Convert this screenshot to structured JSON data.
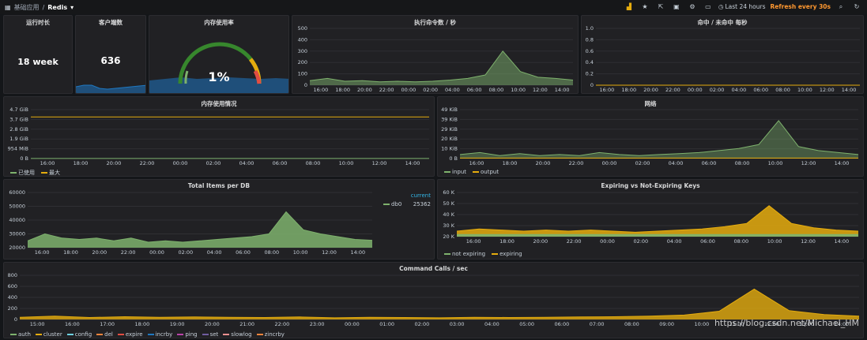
{
  "topbar": {
    "breadcrumb_parent": "基础应用",
    "separator": "/",
    "dashboard": "Redis",
    "time_range": "Last 24 hours",
    "refresh": "Refresh every 30s",
    "icons": [
      "graph-add-icon",
      "star-icon",
      "share-icon",
      "save-icon",
      "gear-icon",
      "tv-icon",
      "clock-icon",
      "zoom-out-icon",
      "refresh-icon"
    ]
  },
  "panels": {
    "uptime": {
      "title": "运行时长",
      "value": "18 week"
    },
    "clients": {
      "title": "客户端数",
      "value": "636"
    },
    "mem_usage": {
      "title": "内存使用率",
      "value": "1%"
    },
    "cmds_per_sec": {
      "title": "执行命令数 / 秒"
    },
    "hit_miss": {
      "title": "命中 / 未命中 每秒"
    },
    "mem_usage_detail": {
      "title": "内存使用情况"
    },
    "network": {
      "title": "网络"
    },
    "items_per_db": {
      "title": "Total Items per DB",
      "legend_header": "current",
      "legend_series": "db0",
      "legend_value": "25362"
    },
    "expiring": {
      "title": "Expiring vs Not-Expiring Keys"
    },
    "command_calls": {
      "title": "Command Calls / sec"
    }
  },
  "colors": {
    "green": "#7eb26d",
    "yellow": "#e5ac0e",
    "blue": "#1f78c1",
    "red": "#e24d42",
    "orange": "#ef843c",
    "cyan": "#6ed0e0",
    "purple": "#ba43a9",
    "pink": "#f29191",
    "violet": "#705da0",
    "mint": "#badff4"
  },
  "chart_data": [
    {
      "id": "cmds_per_sec",
      "type": "area",
      "title": "执行命令数 / 秒",
      "x": [
        "16:00",
        "18:00",
        "20:00",
        "22:00",
        "00:00",
        "02:00",
        "04:00",
        "06:00",
        "08:00",
        "10:00",
        "12:00",
        "14:00"
      ],
      "ylim": [
        0,
        500
      ],
      "yticks": [
        "0",
        "100",
        "200",
        "300",
        "400",
        "500"
      ],
      "series": [
        {
          "values": [
            40,
            60,
            35,
            40,
            30,
            35,
            30,
            35,
            45,
            60,
            90,
            300,
            120,
            70,
            60,
            45
          ]
        }
      ]
    },
    {
      "id": "hit_miss",
      "type": "line",
      "title": "命中 / 未命中 每秒",
      "x": [
        "16:00",
        "18:00",
        "20:00",
        "22:00",
        "00:00",
        "02:00",
        "04:00",
        "06:00",
        "08:00",
        "10:00",
        "12:00",
        "14:00"
      ],
      "ylim": [
        0,
        1.0
      ],
      "yticks": [
        "0",
        "0.2",
        "0.4",
        "0.6",
        "0.8",
        "1.0"
      ],
      "series": [
        {
          "values": [
            0,
            0,
            0,
            0,
            0,
            0,
            0,
            0,
            0,
            0,
            0,
            0
          ]
        }
      ]
    },
    {
      "id": "mem_usage_detail",
      "type": "line",
      "title": "内存使用情况",
      "x": [
        "16:00",
        "18:00",
        "20:00",
        "22:00",
        "00:00",
        "02:00",
        "04:00",
        "06:00",
        "08:00",
        "10:00",
        "12:00",
        "14:00"
      ],
      "yticks": [
        "0 B",
        "954 MiB",
        "1.9 GiB",
        "2.8 GiB",
        "3.7 GiB",
        "4.7 GiB"
      ],
      "ylim": [
        0,
        4.7
      ],
      "legend": [
        "已使用",
        "最大"
      ],
      "series": [
        {
          "name": "已使用",
          "values": [
            0.01,
            0.01
          ]
        },
        {
          "name": "最大",
          "values": [
            4.0,
            4.0
          ]
        }
      ]
    },
    {
      "id": "network",
      "type": "area",
      "title": "网络",
      "x": [
        "16:00",
        "18:00",
        "20:00",
        "22:00",
        "00:00",
        "02:00",
        "04:00",
        "06:00",
        "08:00",
        "10:00",
        "12:00",
        "14:00"
      ],
      "yticks": [
        "0 B",
        "10 KiB",
        "20 KiB",
        "29 KiB",
        "39 KiB",
        "49 KiB"
      ],
      "ylim": [
        0,
        49
      ],
      "legend": [
        "input",
        "output"
      ],
      "series": [
        {
          "name": "input",
          "values": [
            4,
            6,
            3,
            5,
            3,
            4,
            3,
            6,
            4,
            3,
            4,
            5,
            6,
            8,
            10,
            14,
            38,
            12,
            8,
            6,
            4
          ]
        },
        {
          "name": "output",
          "values": [
            0.5,
            0.5,
            0.5,
            0.5,
            0.5,
            0.5,
            0.5,
            0.5,
            0.5,
            0.5,
            0.5,
            0.5,
            0.5,
            0.5,
            0.5,
            0.5,
            0.5,
            0.5,
            0.5,
            0.5,
            0.5
          ]
        }
      ]
    },
    {
      "id": "items_per_db",
      "type": "area",
      "title": "Total Items per DB",
      "x": [
        "16:00",
        "18:00",
        "20:00",
        "22:00",
        "00:00",
        "02:00",
        "04:00",
        "06:00",
        "08:00",
        "10:00",
        "12:00",
        "14:00"
      ],
      "yticks": [
        "20000",
        "30000",
        "40000",
        "50000",
        "60000"
      ],
      "ylim": [
        20000,
        60000
      ],
      "series": [
        {
          "name": "db0",
          "values": [
            25000,
            30000,
            27000,
            26000,
            27000,
            25000,
            27000,
            24000,
            25000,
            24000,
            25000,
            26000,
            27000,
            28000,
            30000,
            46000,
            33000,
            30000,
            28000,
            26000,
            25362
          ]
        }
      ]
    },
    {
      "id": "expiring",
      "type": "area",
      "title": "Expiring vs Not-Expiring Keys",
      "x": [
        "16:00",
        "18:00",
        "20:00",
        "22:00",
        "00:00",
        "02:00",
        "04:00",
        "06:00",
        "08:00",
        "10:00",
        "12:00",
        "14:00"
      ],
      "yticks": [
        "20 K",
        "30 K",
        "40 K",
        "50 K",
        "60 K"
      ],
      "ylim": [
        20000,
        60000
      ],
      "legend": [
        "not expiring",
        "expiring"
      ],
      "series": [
        {
          "name": "not expiring",
          "values": [
            22000,
            22000
          ]
        },
        {
          "name": "expiring",
          "values": [
            25000,
            27000,
            26000,
            25000,
            26000,
            25000,
            26000,
            25000,
            24000,
            25000,
            26000,
            27000,
            29000,
            32000,
            48000,
            32000,
            28000,
            26000,
            25000
          ]
        }
      ]
    },
    {
      "id": "command_calls",
      "type": "area",
      "title": "Command Calls / sec",
      "x": [
        "15:00",
        "16:00",
        "17:00",
        "18:00",
        "19:00",
        "20:00",
        "21:00",
        "22:00",
        "23:00",
        "00:00",
        "01:00",
        "02:00",
        "03:00",
        "04:00",
        "05:00",
        "06:00",
        "07:00",
        "08:00",
        "09:00",
        "10:00",
        "11:00",
        "12:00",
        "13:00",
        "14:00"
      ],
      "yticks": [
        "0",
        "200",
        "400",
        "600",
        "800"
      ],
      "ylim": [
        0,
        800
      ],
      "legend": [
        "auth",
        "cluster",
        "config",
        "del",
        "expire",
        "incrby",
        "ping",
        "set",
        "slowlog",
        "zincrby"
      ],
      "series": [
        {
          "name": "zincrby",
          "values": [
            40,
            60,
            35,
            50,
            40,
            45,
            40,
            35,
            45,
            30,
            40,
            35,
            30,
            40,
            35,
            40,
            45,
            50,
            60,
            80,
            150,
            550,
            160,
            90,
            60
          ]
        }
      ]
    }
  ],
  "watermark": "https://blog.csdn.net/Michael_HM"
}
